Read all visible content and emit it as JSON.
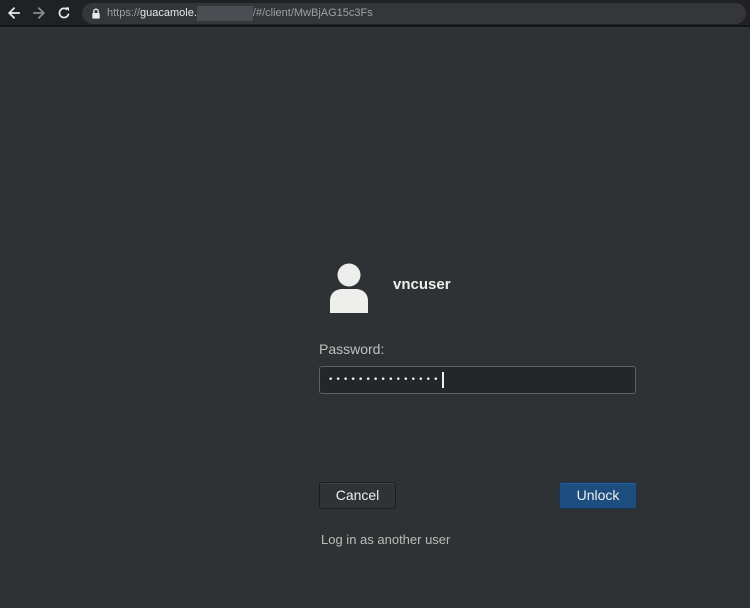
{
  "browser": {
    "url_prefix": "https://",
    "url_host": "guacamole.",
    "url_path": "/#/client/MwBjAG15c3Fs",
    "icons": {
      "back": "arrow-left-icon",
      "forward": "arrow-right-icon",
      "reload": "reload-icon",
      "security": "lock-icon"
    }
  },
  "lock_screen": {
    "avatar_icon": "user-avatar-icon",
    "username": "vncuser",
    "password_label": "Password:",
    "password_value": "•••••••••••••••",
    "cancel_label": "Cancel",
    "unlock_label": "Unlock",
    "other_user_link": "Log in as another user"
  },
  "colors": {
    "background": "#2e3235",
    "accent_button": "#1e4e7f",
    "text": "#eeeeec"
  }
}
